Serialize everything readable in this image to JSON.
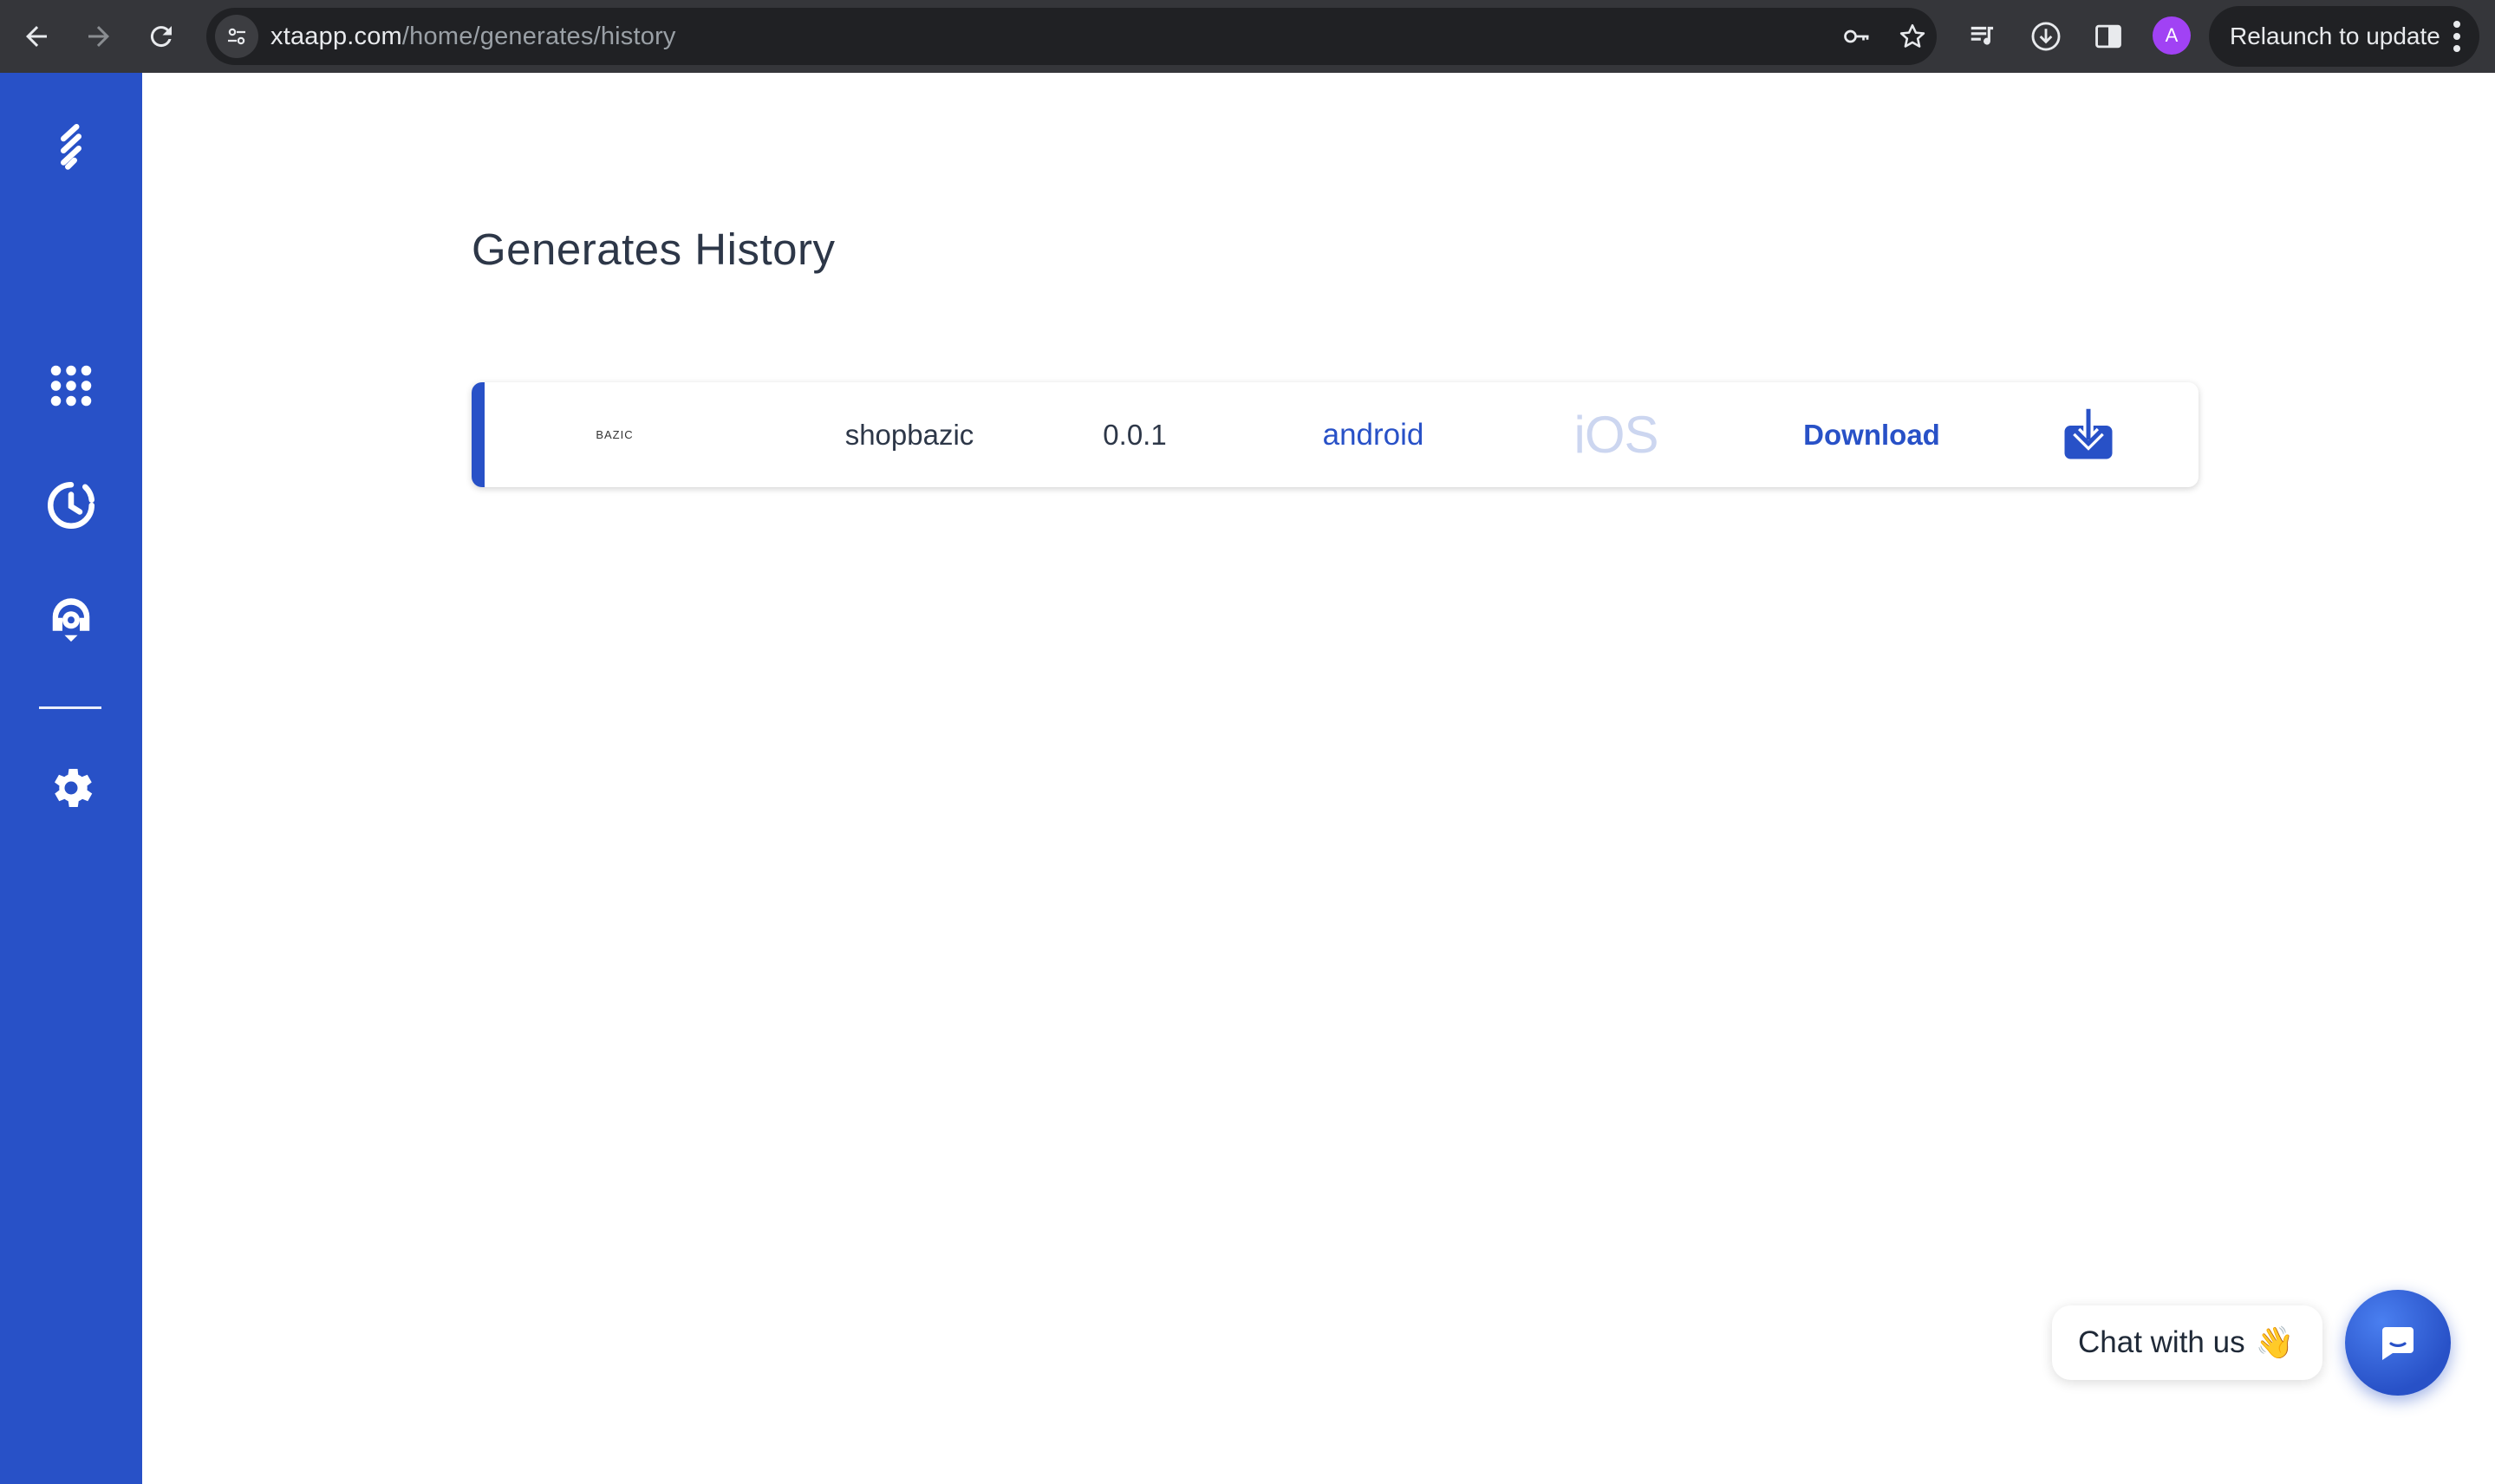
{
  "browser": {
    "url_host": "xtaapp.com",
    "url_path": "/home/generates/history",
    "avatar_letter": "A",
    "relaunch_label": "Relaunch to update"
  },
  "page": {
    "title": "Generates History"
  },
  "history": [
    {
      "logo_text": "BAZIC",
      "name": "shopbazic",
      "version": "0.0.1",
      "android_label": "android",
      "ios_label": "iOS",
      "download_label": "Download"
    }
  ],
  "chat": {
    "bubble_text": "Chat with us",
    "emoji": "👋"
  },
  "colors": {
    "sidebar": "#2851c7",
    "accent": "#2851c7",
    "chrome": "#35363a",
    "ios_disabled": "#ccd6f0"
  },
  "icons": {
    "sidebar": [
      "logo-icon",
      "apps-grid-icon",
      "history-clock-icon",
      "support-agent-icon",
      "settings-gear-icon"
    ]
  }
}
